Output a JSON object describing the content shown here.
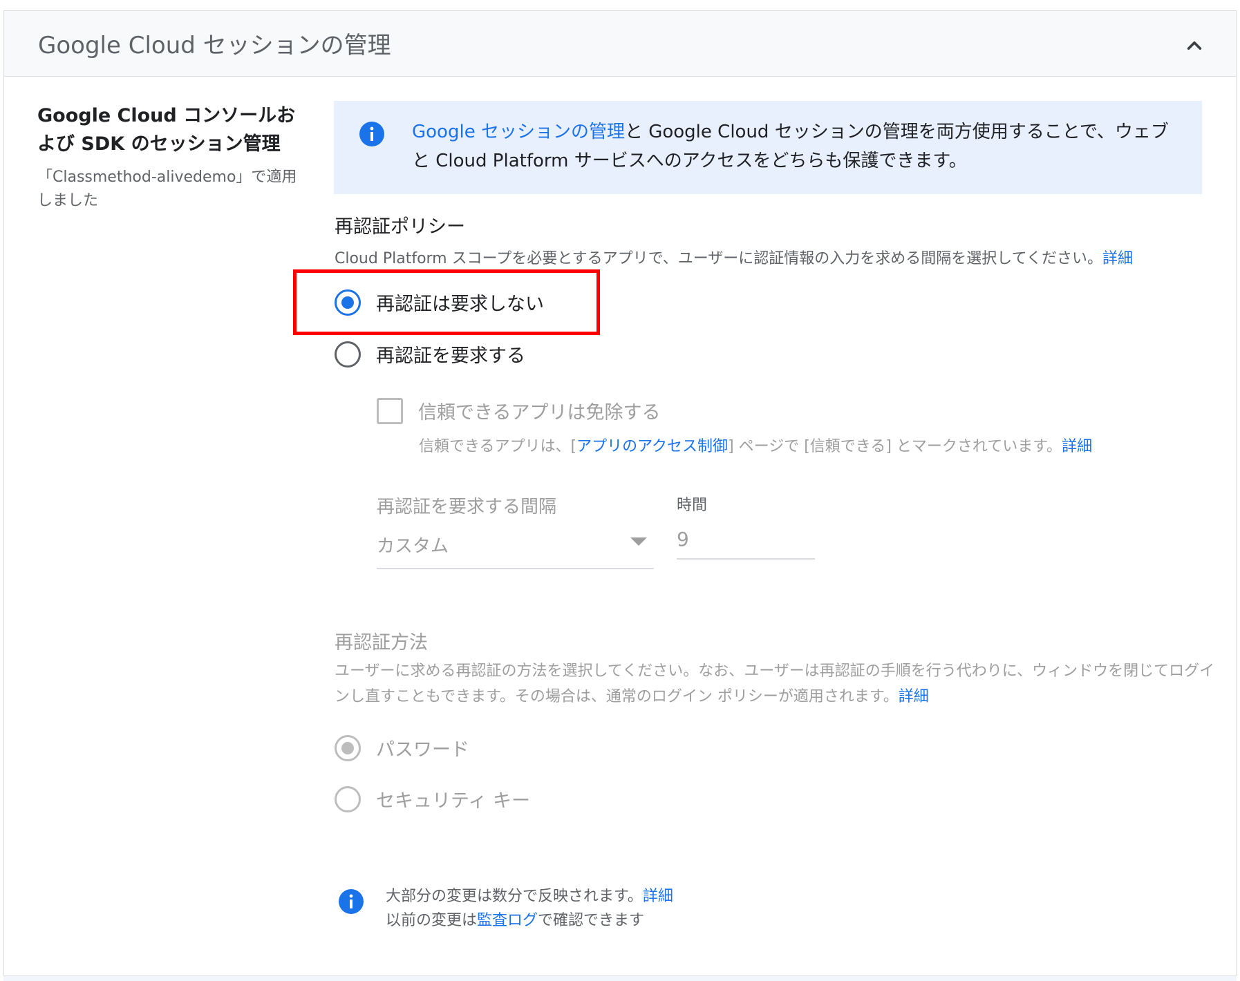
{
  "header": {
    "title": "Google Cloud セッションの管理",
    "collapse_icon": "chevron-up-icon"
  },
  "section": {
    "label": "Google Cloud コンソールおよび SDK のセッション管理",
    "sublabel": "「Classmethod-alivedemo」で適用しました"
  },
  "info_box": {
    "icon": "info-icon",
    "link": "Google セッションの管理",
    "text": "と Google Cloud セッションの管理を両方使用することで、ウェブと Cloud Platform サービスへのアクセスをどちらも保護できます。"
  },
  "reauth_policy": {
    "heading": "再認証ポリシー",
    "description": "Cloud Platform スコープを必要とするアプリで、ユーザーに認証情報の入力を求める間隔を選択してください。",
    "details_link": "詳細",
    "options": [
      {
        "label": "再認証は要求しない",
        "checked": true
      },
      {
        "label": "再認証を要求する",
        "checked": false
      }
    ],
    "exempt_checkbox": {
      "label": "信頼できるアプリは免除する",
      "checked": false,
      "desc_before": "信頼できるアプリは、[",
      "desc_link": "アプリのアクセス制御",
      "desc_after": "] ページで [信頼できる] とマークされています。",
      "details_link": "詳細"
    },
    "interval": {
      "label": "再認証を要求する間隔",
      "selected": "カスタム",
      "hours_label": "時間",
      "hours_value": "9"
    }
  },
  "reauth_method": {
    "heading": "再認証方法",
    "description": "ユーザーに求める再認証の方法を選択してください。なお、ユーザーは再認証の手順を行う代わりに、ウィンドウを閉じてログインし直すこともできます。その場合は、通常のログイン ポリシーが適用されます。",
    "details_link": "詳細",
    "options": [
      {
        "label": "パスワード",
        "checked": true
      },
      {
        "label": "セキュリティ キー",
        "checked": false
      }
    ]
  },
  "footer": {
    "line1": "大部分の変更は数分で反映されます。",
    "line1_link": "詳細",
    "line2_before": "以前の変更は",
    "line2_link": "監査ログ",
    "line2_after": "で確認できます"
  },
  "colors": {
    "accent": "#1a73e8",
    "info_bg": "#e8f0fe",
    "highlight": "#ff0000",
    "disabled": "#9e9e9e"
  }
}
